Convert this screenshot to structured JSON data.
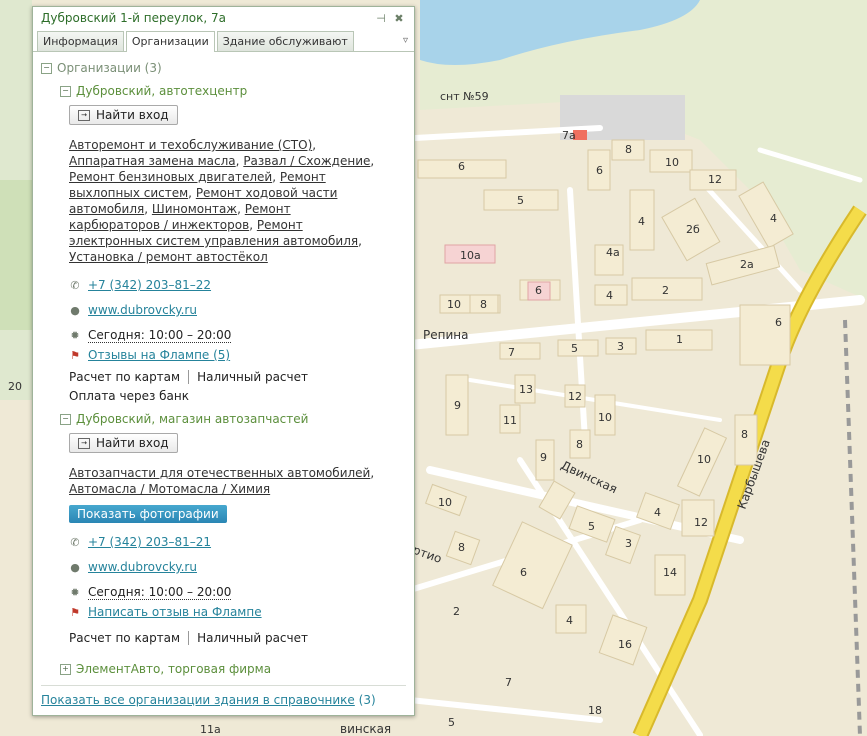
{
  "map": {
    "labels": {
      "snt": "снт №59",
      "street_repina": "Репина",
      "street_dvinskaya": "Двинская",
      "street_dvinskaya_bottom": "винская",
      "street_karbysheva": "Карбышева",
      "street_partial": "ртио",
      "b_6a": "6",
      "b_8a": "8",
      "b_10a": "10",
      "b_12a": "12",
      "b_5a": "5",
      "b_7a": "7а",
      "b_6b": "6",
      "b_4a": "4",
      "b_2b": "2б",
      "b_4b": "4",
      "b_4c": "4а",
      "b_2a": "2а",
      "b_10b": "10а",
      "b_10c": "10",
      "b_8b": "8",
      "b_6c": "6",
      "b_4d": "4",
      "b_2c": "2",
      "b_6d": "6",
      "b_7b": "7",
      "b_5b": "5",
      "b_3a": "3",
      "b_1a": "1",
      "b_9a": "9",
      "b_13a": "13",
      "b_11a": "11",
      "b_12b": "12",
      "b_10d": "10",
      "b_8c": "8",
      "b_8d": "8",
      "b_10e": "10",
      "b_9b": "9",
      "b_10f": "10",
      "b_8e": "8",
      "b_6e": "6",
      "b_5c": "5",
      "b_3b": "3",
      "b_4e": "4",
      "b_12c": "12",
      "b_14a": "14",
      "b_16a": "16",
      "b_4f": "4",
      "b_2d": "2",
      "b_7c": "7",
      "b_5d": "5",
      "b_18a": "18",
      "b_20a": "20",
      "b_11b": "11а"
    }
  },
  "popup": {
    "title": "Дубровский 1-й переулок, 7а",
    "tabs": [
      "Информация",
      "Организации",
      "Здание обслуживают"
    ],
    "group_title": "Организации (3)",
    "orgs": [
      {
        "name": "Дубровский, автотехцентр",
        "login_label": "Найти вход",
        "rubrics": [
          "Авторемонт и техобслуживание (СТО)",
          "Аппаратная замена масла",
          "Развал / Схождение",
          "Ремонт бензиновых двигателей",
          "Ремонт выхлопных систем",
          "Ремонт ходовой части автомобиля",
          "Шиномонтаж",
          "Ремонт карбюраторов / инжекторов",
          "Ремонт электронных систем управления автомобиля",
          "Установка / ремонт автостёкол"
        ],
        "phone": "+7 (342) 203–81–22",
        "site": "www.dubrovcky.ru",
        "hours": "Сегодня: 10:00 – 20:00",
        "reviews": "Отзывы на Флампе (5)",
        "payments": [
          "Расчет по картам",
          "Наличный расчет",
          "Оплата через банк"
        ]
      },
      {
        "name": "Дубровский, магазин автозапчастей",
        "login_label": "Найти вход",
        "rubrics": [
          "Автозапчасти для отечественных автомобилей",
          "Автомасла / Мотомасла / Химия"
        ],
        "photos_label": "Показать фотографии",
        "phone": "+7 (342) 203–81–21",
        "site": "www.dubrovcky.ru",
        "hours": "Сегодня: 10:00 – 20:00",
        "reviews": "Написать отзыв на Флампе",
        "payments": [
          "Расчет по картам",
          "Наличный расчет"
        ]
      },
      {
        "name": "ЭлементАвто, торговая фирма"
      }
    ],
    "footer_link": "Показать все организации здания в справочнике",
    "footer_count": "(3)"
  },
  "colors": {
    "accent_green": "#5c8f3c",
    "link_blue": "#25839b",
    "map_bg": "#efe9d6",
    "water": "#a8d3ea",
    "road_main": "#f1d43f"
  },
  "icons": [
    "pin-icon",
    "close-icon",
    "chevron-down-icon",
    "login-icon",
    "phone-icon",
    "globe-icon",
    "clock-icon",
    "flamp-icon",
    "expand-icon",
    "collapse-icon"
  ]
}
